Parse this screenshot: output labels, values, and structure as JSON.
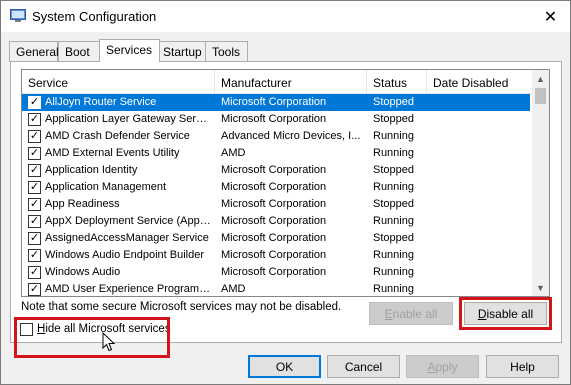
{
  "window": {
    "title": "System Configuration",
    "close_glyph": "✕"
  },
  "tabs": [
    {
      "label": "General",
      "active": false
    },
    {
      "label": "Boot",
      "active": false
    },
    {
      "label": "Services",
      "active": true
    },
    {
      "label": "Startup",
      "active": false
    },
    {
      "label": "Tools",
      "active": false
    }
  ],
  "list": {
    "headers": {
      "service": "Service",
      "manufacturer": "Manufacturer",
      "status": "Status",
      "date_disabled": "Date Disabled"
    },
    "rows": [
      {
        "checked": true,
        "service": "AllJoyn Router Service",
        "manufacturer": "Microsoft Corporation",
        "status": "Stopped",
        "date": "",
        "selected": true
      },
      {
        "checked": true,
        "service": "Application Layer Gateway Service",
        "manufacturer": "Microsoft Corporation",
        "status": "Stopped",
        "date": ""
      },
      {
        "checked": true,
        "service": "AMD Crash Defender Service",
        "manufacturer": "Advanced Micro Devices, I...",
        "status": "Running",
        "date": ""
      },
      {
        "checked": true,
        "service": "AMD External Events Utility",
        "manufacturer": "AMD",
        "status": "Running",
        "date": ""
      },
      {
        "checked": true,
        "service": "Application Identity",
        "manufacturer": "Microsoft Corporation",
        "status": "Stopped",
        "date": ""
      },
      {
        "checked": true,
        "service": "Application Management",
        "manufacturer": "Microsoft Corporation",
        "status": "Running",
        "date": ""
      },
      {
        "checked": true,
        "service": "App Readiness",
        "manufacturer": "Microsoft Corporation",
        "status": "Stopped",
        "date": ""
      },
      {
        "checked": true,
        "service": "AppX Deployment Service (AppX...",
        "manufacturer": "Microsoft Corporation",
        "status": "Running",
        "date": ""
      },
      {
        "checked": true,
        "service": "AssignedAccessManager Service",
        "manufacturer": "Microsoft Corporation",
        "status": "Stopped",
        "date": ""
      },
      {
        "checked": true,
        "service": "Windows Audio Endpoint Builder",
        "manufacturer": "Microsoft Corporation",
        "status": "Running",
        "date": ""
      },
      {
        "checked": true,
        "service": "Windows Audio",
        "manufacturer": "Microsoft Corporation",
        "status": "Running",
        "date": ""
      },
      {
        "checked": true,
        "service": "AMD User Experience Program D...",
        "manufacturer": "AMD",
        "status": "Running",
        "date": ""
      }
    ]
  },
  "note": "Note that some secure Microsoft services may not be disabled.",
  "buttons": {
    "enable_all": {
      "underline": "E",
      "rest": "nable all"
    },
    "disable_all": {
      "underline": "D",
      "rest": "isable all"
    },
    "ok": "OK",
    "cancel": "Cancel",
    "apply": {
      "underline": "A",
      "rest": "pply"
    },
    "help": "Help"
  },
  "hide_ms": {
    "underline": "H",
    "rest": "ide all Microsoft services",
    "checked": false
  },
  "colors": {
    "selection": "#0078d7",
    "highlight": "#d4141b"
  },
  "icons": {
    "check": "✓",
    "scroll_up": "▲",
    "scroll_down": "▼"
  }
}
